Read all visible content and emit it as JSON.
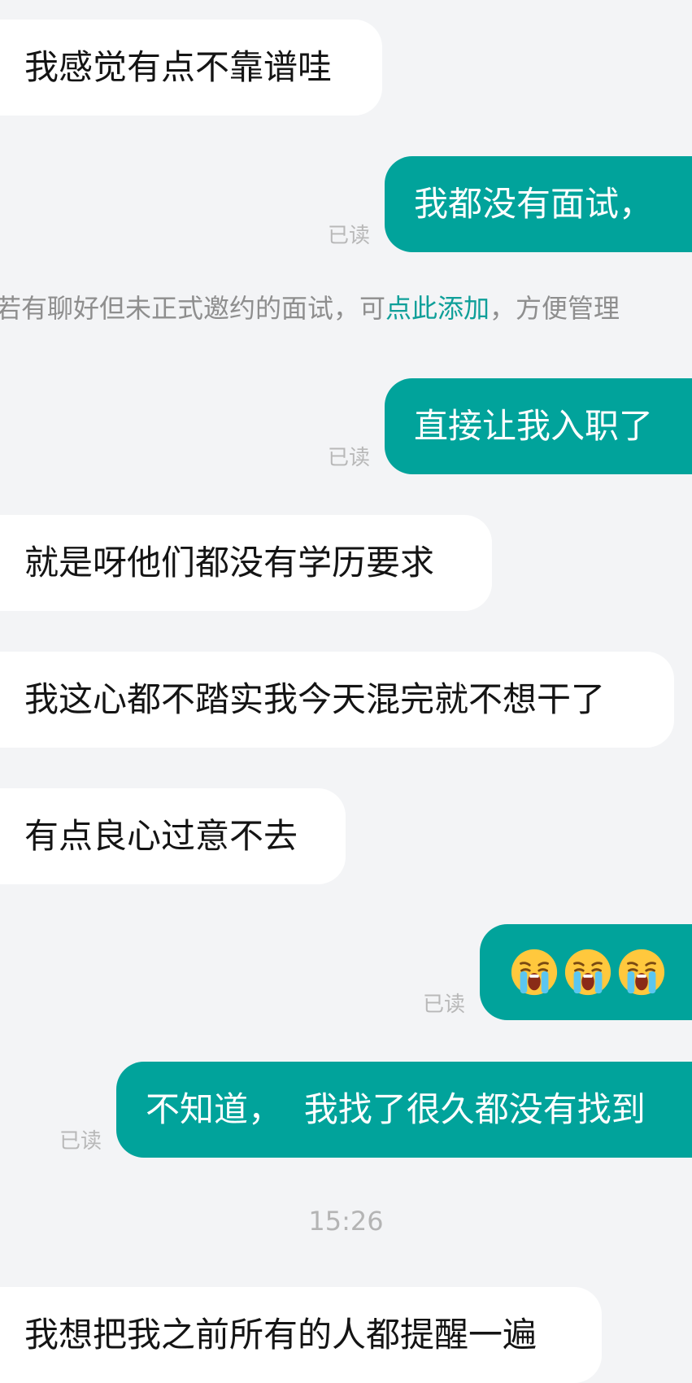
{
  "messages": [
    {
      "side": "in",
      "text": "我感觉有点不靠谱哇"
    },
    {
      "side": "out",
      "text": "我都没有面试，",
      "status": "已读"
    },
    {
      "side": "out",
      "text": "直接让我入职了",
      "status": "已读"
    },
    {
      "side": "in",
      "text": "就是呀他们都没有学历要求"
    },
    {
      "side": "in",
      "text": "我这心都不踏实我今天混完就不想干了"
    },
    {
      "side": "in",
      "text": "有点良心过意不去"
    },
    {
      "side": "out",
      "emoji": "loudly-crying-face-icon",
      "count": 3,
      "status": "已读"
    },
    {
      "side": "out",
      "text": "不知道，  我找了很久都没有找到",
      "status": "已读"
    },
    {
      "side": "in",
      "text": "我想把我之前所有的人都提醒一遍"
    }
  ],
  "notice": {
    "prefix": "若有聊好但未正式邀约的面试，可",
    "link": "点此添加",
    "suffix": "，方便管理"
  },
  "timestamp": "15:26",
  "colors": {
    "background": "#f3f4f6",
    "outgoing_bubble": "#01a39b",
    "incoming_bubble": "#ffffff",
    "link": "#0f9f99"
  }
}
